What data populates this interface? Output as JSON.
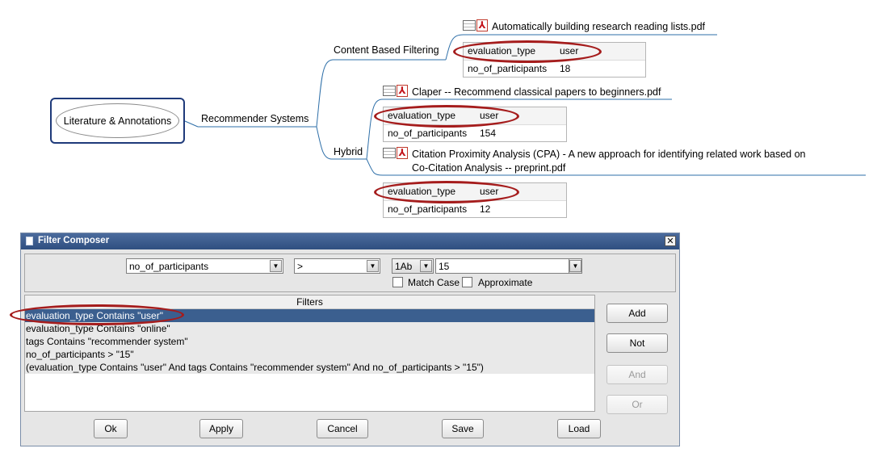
{
  "mindmap": {
    "root": "Literature & Annotations",
    "branch": "Recommender Systems",
    "sub_content": "Content Based Filtering",
    "sub_hybrid": "Hybrid",
    "papers": [
      {
        "title": "Automatically building research reading lists.pdf",
        "attributes": [
          {
            "key": "evaluation_type",
            "value": "user"
          },
          {
            "key": "no_of_participants",
            "value": "18"
          }
        ]
      },
      {
        "title": "Claper -- Recommend classical papers to beginners.pdf",
        "attributes": [
          {
            "key": "evaluation_type",
            "value": "user"
          },
          {
            "key": "no_of_participants",
            "value": "154"
          }
        ]
      },
      {
        "title_line1": "Citation Proximity Analysis (CPA) - A new approach for identifying related work based on",
        "title_line2": "Co-Citation Analysis -- preprint.pdf",
        "attributes": [
          {
            "key": "evaluation_type",
            "value": "user"
          },
          {
            "key": "no_of_participants",
            "value": "12"
          }
        ]
      }
    ],
    "highlight_color": "#a51c1c",
    "link_color": "#2e6fa8"
  },
  "dialog": {
    "title": "Filter Composer",
    "close_glyph": "✕",
    "attribute_select": "no_of_participants",
    "operator_select": ">",
    "type_select": "1Ab",
    "value_input": "15",
    "match_case_label": "Match Case",
    "approximate_label": "Approximate",
    "filters_header": "Filters",
    "filters": [
      "evaluation_type Contains \"user\"",
      "evaluation_type Contains \"online\"",
      "tags Contains \"recommender system\"",
      "no_of_participants > \"15\"",
      "(evaluation_type Contains \"user\" And tags Contains \"recommender system\" And no_of_participants > \"15\")"
    ],
    "side_buttons": {
      "add": "Add",
      "not": "Not",
      "and": "And",
      "or": "Or"
    },
    "bottom_buttons": {
      "ok": "Ok",
      "apply": "Apply",
      "cancel": "Cancel",
      "save": "Save",
      "load": "Load"
    },
    "title_bar_color": "#3b5f8f",
    "selection_color": "#3b5f8f"
  }
}
